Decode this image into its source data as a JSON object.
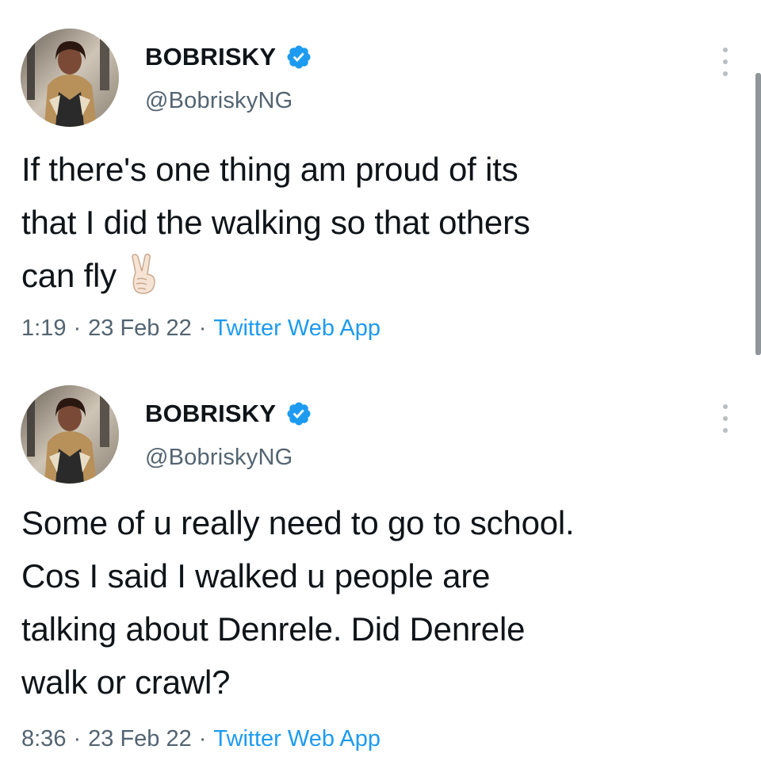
{
  "tweets": [
    {
      "author": {
        "display_name": "BOBRISKY",
        "handle": "@BobriskyNG",
        "verified": true,
        "avatar_icon": "profile-photo"
      },
      "text_lines": [
        "If there's one thing am proud of its",
        "that I did the walking so that others",
        "can fly"
      ],
      "emoji": "victory-hand-icon",
      "time": "1:19",
      "date": "23 Feb 22",
      "separator": "·",
      "source": "Twitter Web App"
    },
    {
      "author": {
        "display_name": "BOBRISKY",
        "handle": "@BobriskyNG",
        "verified": true,
        "avatar_icon": "profile-photo"
      },
      "text_lines": [
        "Some of u really need to go to school.",
        "Cos I said I walked u people are",
        "talking about Denrele. Did Denrele",
        "walk or crawl?"
      ],
      "time": "8:36",
      "date": "23 Feb 22",
      "separator": "·",
      "source": "Twitter Web App"
    }
  ],
  "colors": {
    "text": "#0f1419",
    "secondary_text": "#536471",
    "link": "#1d9bf0",
    "verified_badge": "#1d9bf0",
    "background": "#ffffff"
  }
}
